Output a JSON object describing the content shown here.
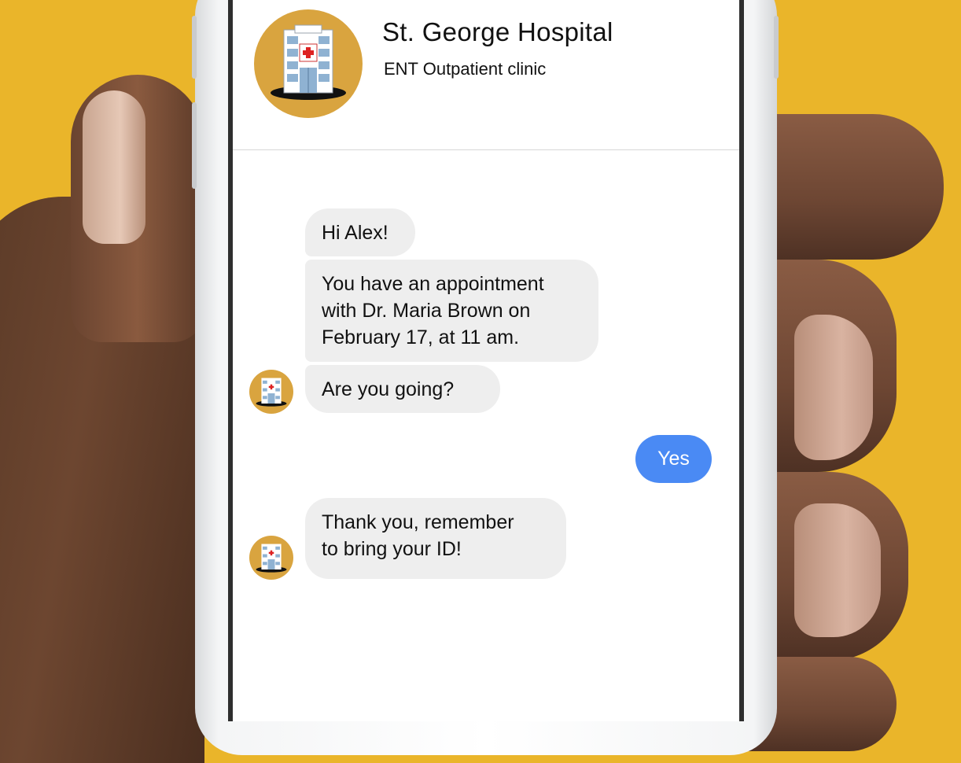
{
  "chat": {
    "name": "St. George Hospital",
    "subtitle": "ENT Outpatient clinic",
    "messages": {
      "m1": "Hi Alex!",
      "m2_lines": [
        "You have an appointment",
        "with Dr. Maria Brown on",
        "February 17, at 11 am."
      ],
      "m3": "Are you going?",
      "reply": "Yes",
      "m4_lines": [
        "Thank you, remember",
        "to bring your ID!"
      ]
    }
  },
  "colors": {
    "background": "#eab52a",
    "avatar_bg": "#d9a43f",
    "incoming_bubble": "#eeeeee",
    "outgoing_bubble": "#4a8af4"
  },
  "icons": {
    "avatar": "hospital-building-icon"
  }
}
